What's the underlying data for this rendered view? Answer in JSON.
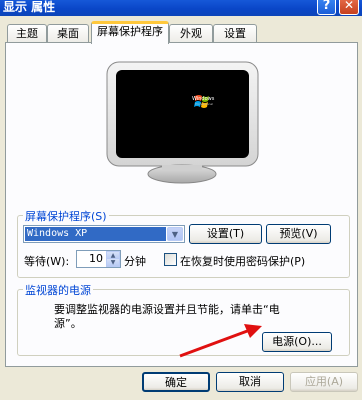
{
  "window": {
    "title": "显示 属性",
    "help_label": "?",
    "close_label": "✕"
  },
  "tabs": [
    {
      "label": "主题"
    },
    {
      "label": "桌面"
    },
    {
      "label": "屏幕保护程序",
      "active": true
    },
    {
      "label": "外观"
    },
    {
      "label": "设置"
    }
  ],
  "preview": {
    "logo_text": "Windows",
    "logo_sub": "Professional"
  },
  "screensaver": {
    "group_title": "屏幕保护程序(S)",
    "selected": "Windows XP",
    "settings_button": "设置(T)",
    "preview_button": "预览(V)",
    "wait_label": "等待(W):",
    "wait_value": "10",
    "wait_unit": "分钟",
    "password_label": "在恢复时使用密码保护(P)",
    "password_checked": false
  },
  "power": {
    "group_title": "监视器的电源",
    "description_line1": "要调整监视器的电源设置并且节能，请单击“电",
    "description_line2": "源”。",
    "power_button": "电源(O)..."
  },
  "footer": {
    "ok_label": "确定",
    "cancel_label": "取消",
    "apply_label": "应用(A)"
  },
  "colors": {
    "titlebar": "#0A46C8",
    "group_title": "#0046D5",
    "tab_highlight": "#FFC83C",
    "annotation_arrow": "#E01010"
  }
}
